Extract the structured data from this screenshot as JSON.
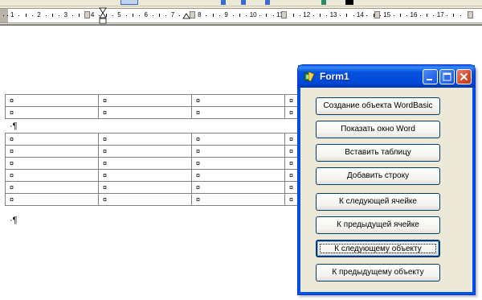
{
  "form": {
    "title": "Form1",
    "buttons": [
      {
        "label": "Создание объекта WordBasic"
      },
      {
        "label": "Показать окно Word"
      },
      {
        "label": "Вставить таблицу"
      },
      {
        "label": "Добавить строку"
      },
      {
        "label": "К следующей ячейке"
      },
      {
        "label": "К предыдущей ячейке"
      },
      {
        "label": "К следующему объекту"
      },
      {
        "label": "К предыдущему объекту"
      }
    ],
    "focused_button_index": 6
  },
  "ruler": {
    "numbers": [
      "1",
      "2",
      "3",
      "4",
      "5",
      "6",
      "7",
      "8",
      "9",
      "10",
      "11",
      "12",
      "13",
      "14",
      "15",
      "16",
      "17"
    ]
  },
  "document": {
    "paragraph_mark": "¶",
    "cell_mark": "¤",
    "table1_rows": 2,
    "table2_rows": 6,
    "columns_visible": 4
  },
  "colors": {
    "titlebar": "#0054e3",
    "window_face": "#ece9d8",
    "close_button": "#d34a2a"
  },
  "icons": [
    "app-icon",
    "minimize-icon",
    "maximize-icon",
    "close-icon",
    "paragraph-mark-icon",
    "end-of-cell-icon",
    "column-marker-icon",
    "indent-marker-icon"
  ]
}
